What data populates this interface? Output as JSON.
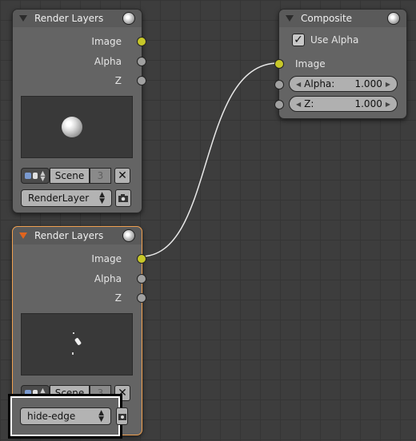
{
  "nodes": {
    "render_layers_1": {
      "title": "Render Layers",
      "outputs": [
        "Image",
        "Alpha",
        "Z"
      ],
      "scene_label": "Scene",
      "scene_count": "3",
      "layer_dropdown": "RenderLayer"
    },
    "render_layers_2": {
      "title": "Render Layers",
      "outputs": [
        "Image",
        "Alpha",
        "Z"
      ],
      "scene_label": "Scene",
      "scene_count": "3",
      "layer_dropdown": "hide-edge"
    },
    "composite": {
      "title": "Composite",
      "use_alpha_label": "Use Alpha",
      "use_alpha_checked": true,
      "input_image": "Image",
      "alpha_label": "Alpha:",
      "alpha_value": "1.000",
      "z_label": "Z:",
      "z_value": "1.000"
    }
  },
  "colors": {
    "image_socket": "#c7c729",
    "socket": "#a1a1a1",
    "active_border": "#f0a050",
    "node_bg": "#646464"
  },
  "icons": [
    "collapse-triangle-icon",
    "preview-sphere-icon",
    "scene-browse-icon",
    "close-icon",
    "camera-icon",
    "checkbox-check-icon"
  ]
}
